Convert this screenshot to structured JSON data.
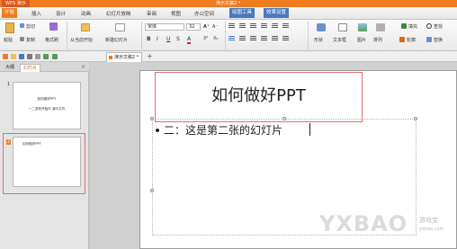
{
  "titlebar": {
    "app": "WPS 演示",
    "doc": "演示文稿2 *"
  },
  "menu": [
    "开始",
    "插入",
    "设计",
    "动画",
    "幻灯片放映",
    "审阅",
    "视图",
    "办公空间",
    "绘图工具",
    "效果设置"
  ],
  "ribbon": {
    "paste": "粘贴",
    "cut": "剪切",
    "copy": "复制",
    "format_painter": "格式刷",
    "from_current": "从当前开始",
    "new_slide": "新建幻灯片",
    "font_name": "宋体",
    "font_size": "32",
    "grow": "A⁺",
    "shrink": "A⁻",
    "bold": "B",
    "italic": "I",
    "underline": "U",
    "strike": "S",
    "color": "A",
    "superscript": "X²",
    "subscript": "X₂",
    "shape": "形状",
    "textbox": "文本框",
    "picture": "图片",
    "arrange": "排列",
    "outline": "轮廓",
    "fill": "填充",
    "find": "查找",
    "replace": "替换"
  },
  "doctab": {
    "label": "演示文稿2 *"
  },
  "panel": {
    "tab_outline": "大纲",
    "tab_slides": "幻灯片",
    "close": "×"
  },
  "thumbnails": [
    {
      "num": "1",
      "line1": "如何做好PPT",
      "line2": "一二多到开始时 演示文件"
    },
    {
      "num": "2",
      "line1": "如何做好PPT"
    }
  ],
  "slide": {
    "title": "如何做好PPT",
    "bullet": "二：这是第二张的幻灯片"
  },
  "watermark": {
    "brand": "YXBAO",
    "cn": "游戏宝",
    "url": "yxbao.com"
  },
  "colors": {
    "accent": "#ef7b1f",
    "selection": "#e06e6e",
    "drawing_tab": "#4a78c0"
  }
}
